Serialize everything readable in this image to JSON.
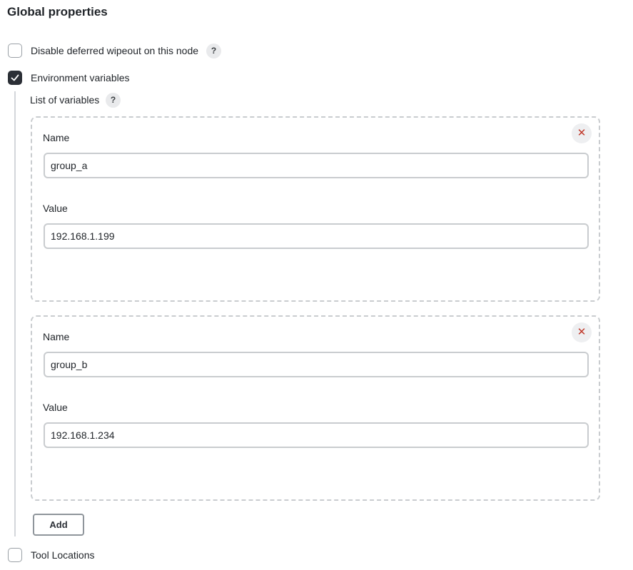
{
  "section": {
    "title": "Global properties"
  },
  "options": {
    "disable_wipeout": {
      "label": "Disable deferred wipeout on this node",
      "checked": false,
      "help": "?"
    },
    "env_vars": {
      "label": "Environment variables",
      "checked": true
    },
    "tool_locations": {
      "label": "Tool Locations",
      "checked": false
    }
  },
  "env": {
    "list_label": "List of variables",
    "list_help": "?",
    "name_label": "Name",
    "value_label": "Value",
    "remove_glyph": "✕",
    "variables": [
      {
        "name": "group_a",
        "value": "192.168.1.199"
      },
      {
        "name": "group_b",
        "value": "192.168.1.234"
      }
    ],
    "add_label": "Add"
  }
}
